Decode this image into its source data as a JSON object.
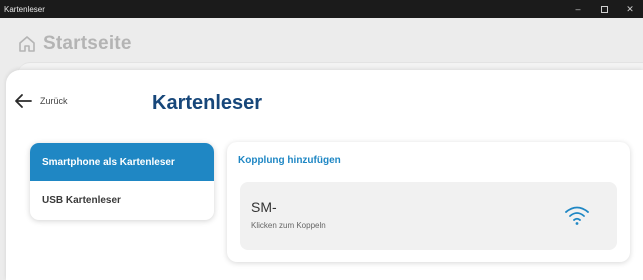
{
  "window": {
    "title": "Kartenleser",
    "minimize_glyph": "–",
    "close_glyph": "✕"
  },
  "background": {
    "home_label": "Startseite",
    "home_icon": "home-icon"
  },
  "header": {
    "back_label": "Zurück",
    "back_icon": "arrow-left-icon",
    "title": "Kartenleser"
  },
  "sidebar": {
    "items": [
      {
        "label": "Smartphone als Kartenleser",
        "active": true
      },
      {
        "label": "USB Kartenleser",
        "active": false
      }
    ]
  },
  "pairing": {
    "title": "Kopplung hinzufügen",
    "device": {
      "name": "SM-",
      "hint": "Klicken zum Koppeln",
      "icon": "wifi-icon"
    }
  },
  "colors": {
    "accent": "#1f87c4",
    "title": "#17477a",
    "titlebar": "#1b1b1b"
  }
}
